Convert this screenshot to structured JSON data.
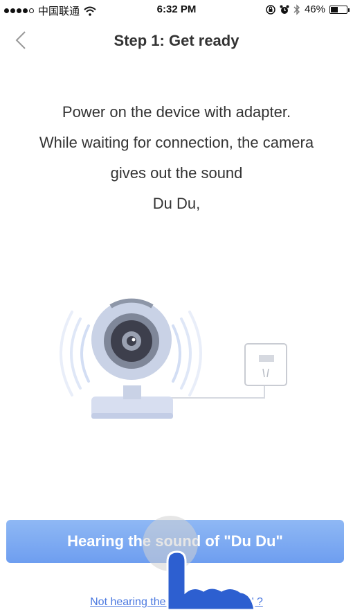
{
  "status_bar": {
    "carrier": "中国联通",
    "time": "6:32 PM",
    "battery": "46%",
    "battery_level": 0.46,
    "icons": [
      "signal-dots-icon",
      "wifi-icon",
      "orientation-lock-icon",
      "alarm-icon",
      "bluetooth-icon",
      "battery-icon"
    ]
  },
  "nav": {
    "back_icon": "chevron-left-icon",
    "title": "Step 1: Get ready"
  },
  "instructions": {
    "lines": [
      "Power on the device with adapter.",
      "While waiting for connection, the camera",
      "gives out the sound",
      "Du Du,"
    ]
  },
  "illustration": {
    "icons": [
      "webcam-icon",
      "sound-waves-icon",
      "power-outlet-icon"
    ]
  },
  "actions": {
    "primary_label": "Hearing the sound of \"Du Du\"",
    "secondary_label": "Not hearing the sound of \"Du Du\" ?"
  },
  "colors": {
    "accent": "#7aa6f2",
    "link": "#4a78e0",
    "camera_body": "#c9d2e6",
    "camera_lens": "#3d3f4c"
  }
}
